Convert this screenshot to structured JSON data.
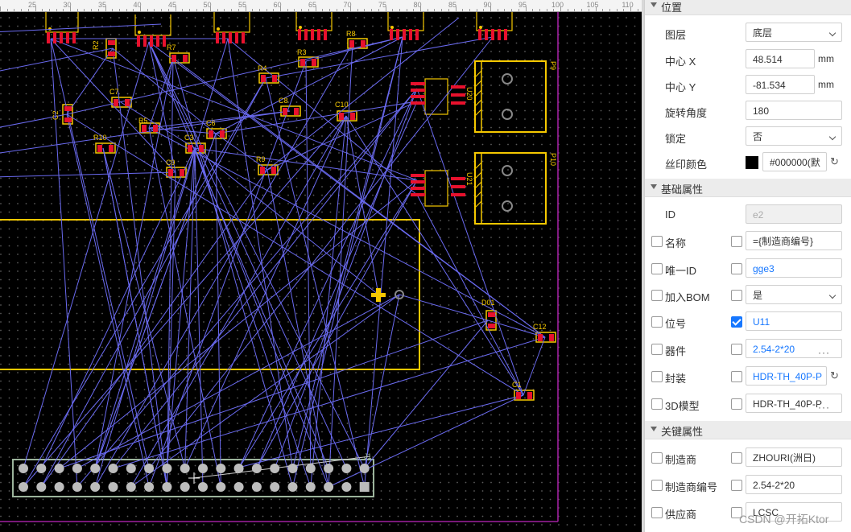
{
  "ruler": {
    "labels": [
      "25",
      "30",
      "35",
      "40",
      "45",
      "50",
      "55",
      "60",
      "65",
      "70",
      "75",
      "80",
      "85",
      "90",
      "95",
      "100",
      "105",
      "110"
    ]
  },
  "board": {
    "designators": [
      "R2",
      "C7",
      "R7",
      "R4",
      "R3",
      "R8",
      "C2",
      "R5",
      "C8",
      "C10",
      "R10",
      "C6",
      "C3",
      "C9",
      "R9",
      "U20",
      "U21",
      "P9",
      "P10",
      "D01",
      "C12",
      "C1"
    ],
    "header_label": "J1",
    "colors": {
      "background": "#000000",
      "silkscreen": "#f5c800",
      "pad": "#e8112d",
      "ratsnest": "#6a6af0",
      "board_outline": "#a020a0",
      "grid": "#505050"
    }
  },
  "panel": {
    "position": {
      "title": "位置",
      "layer_label": "图层",
      "layer_value": "底层",
      "cx_label": "中心 X",
      "cx_value": "48.514",
      "cx_unit": "mm",
      "cy_label": "中心 Y",
      "cy_value": "-81.534",
      "cy_unit": "mm",
      "rot_label": "旋转角度",
      "rot_value": "180",
      "lock_label": "锁定",
      "lock_value": "否",
      "silk_label": "丝印颜色",
      "silk_value": "#000000(默",
      "silk_color": "#000000"
    },
    "basic": {
      "title": "基础属性",
      "id_label": "ID",
      "id_value": "e2",
      "name_label": "名称",
      "name_value": "={制造商编号}",
      "uid_label": "唯一ID",
      "uid_value": "gge3",
      "bom_label": "加入BOM",
      "bom_value": "是",
      "ref_label": "位号",
      "ref_value": "U11",
      "device_label": "器件",
      "device_value": "2.54-2*20",
      "fp_label": "封装",
      "fp_value": "HDR-TH_40P-P",
      "model_label": "3D模型",
      "model_value": "HDR-TH_40P-P"
    },
    "key": {
      "title": "关键属性",
      "mfr_label": "制造商",
      "mfr_value": "ZHOURI(洲日)",
      "mpn_label": "制造商编号",
      "mpn_value": "2.54-2*20",
      "sup_label": "供应商",
      "sup_value": "LCSC"
    }
  },
  "watermark": "CSDN @开拓Ktor"
}
